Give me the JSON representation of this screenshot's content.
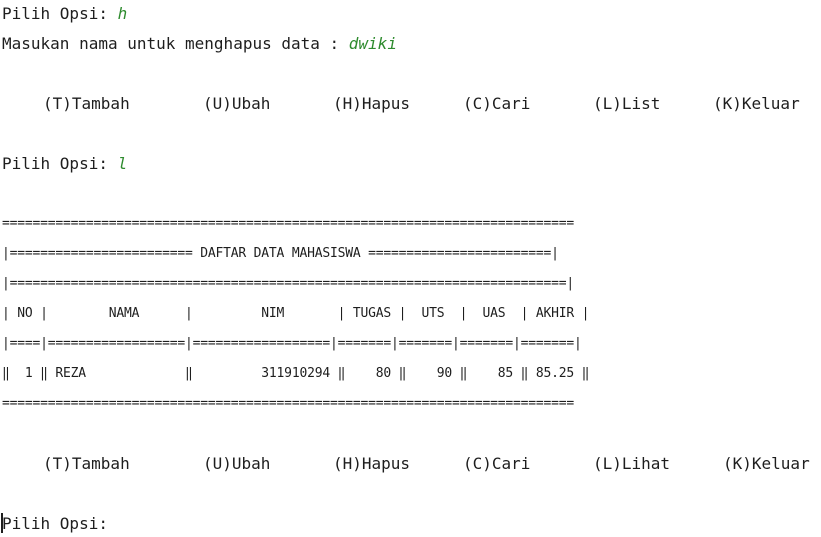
{
  "terminal": {
    "line1_prompt": "Pilih Opsi: ",
    "line1_input": "h",
    "line2_prompt": "Masukan nama untuk menghapus data : ",
    "line2_input": "dwiki",
    "menu1": [
      "(T)Tambah",
      "(U)Ubah",
      "(H)Hapus",
      "(C)Cari",
      "(L)List",
      "(K)Keluar"
    ],
    "line3_prompt": "Pilih Opsi: ",
    "line3_input": "l",
    "table": {
      "border_top": "===========================================================================",
      "title_line": "|======================== DAFTAR DATA MAHASISWA ========================|",
      "sep_line": "|=========================================================================|",
      "header_line": "| NO |        NAMA      |         NIM       | TUGAS |  UTS  |  UAS  | AKHIR |",
      "sep2_line": "|====|==================|==================|=======|=======|=======|=======|",
      "row_line": "‖  1 ‖ REZA             ‖         311910294 ‖    80 ‖    90 ‖    85 ‖ 85.25 ‖",
      "border_bottom": "==========================================================================="
    },
    "menu2": [
      "(T)Tambah",
      "(U)Ubah",
      "(H)Hapus",
      "(C)Cari",
      "(L)Lihat",
      "(K)Keluar"
    ],
    "line4_prompt": "Pilih Opsi: "
  }
}
